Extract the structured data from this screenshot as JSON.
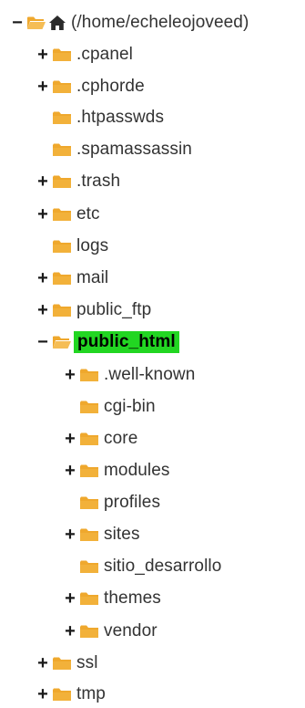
{
  "colors": {
    "folder": "#efa82d",
    "selected_bg": "#22d622",
    "text": "#333333"
  },
  "tree": {
    "root": {
      "label": "(/home/echeleojoveed)",
      "toggle": "−",
      "icons": [
        "open-folder-icon",
        "home-icon"
      ]
    },
    "items": [
      {
        "label": ".cpanel",
        "toggle": "+"
      },
      {
        "label": ".cphorde",
        "toggle": "+"
      },
      {
        "label": ".htpasswds",
        "toggle": ""
      },
      {
        "label": ".spamassassin",
        "toggle": ""
      },
      {
        "label": ".trash",
        "toggle": "+"
      },
      {
        "label": "etc",
        "toggle": "+"
      },
      {
        "label": "logs",
        "toggle": ""
      },
      {
        "label": "mail",
        "toggle": "+"
      },
      {
        "label": "public_ftp",
        "toggle": "+"
      },
      {
        "label": "public_html",
        "toggle": "−",
        "selected": true
      },
      {
        "label": ".well-known",
        "toggle": "+"
      },
      {
        "label": "cgi-bin",
        "toggle": ""
      },
      {
        "label": "core",
        "toggle": "+"
      },
      {
        "label": "modules",
        "toggle": "+"
      },
      {
        "label": "profiles",
        "toggle": ""
      },
      {
        "label": "sites",
        "toggle": "+"
      },
      {
        "label": "sitio_desarrollo",
        "toggle": ""
      },
      {
        "label": "themes",
        "toggle": "+"
      },
      {
        "label": "vendor",
        "toggle": "+"
      },
      {
        "label": "ssl",
        "toggle": "+"
      },
      {
        "label": "tmp",
        "toggle": "+"
      }
    ]
  }
}
